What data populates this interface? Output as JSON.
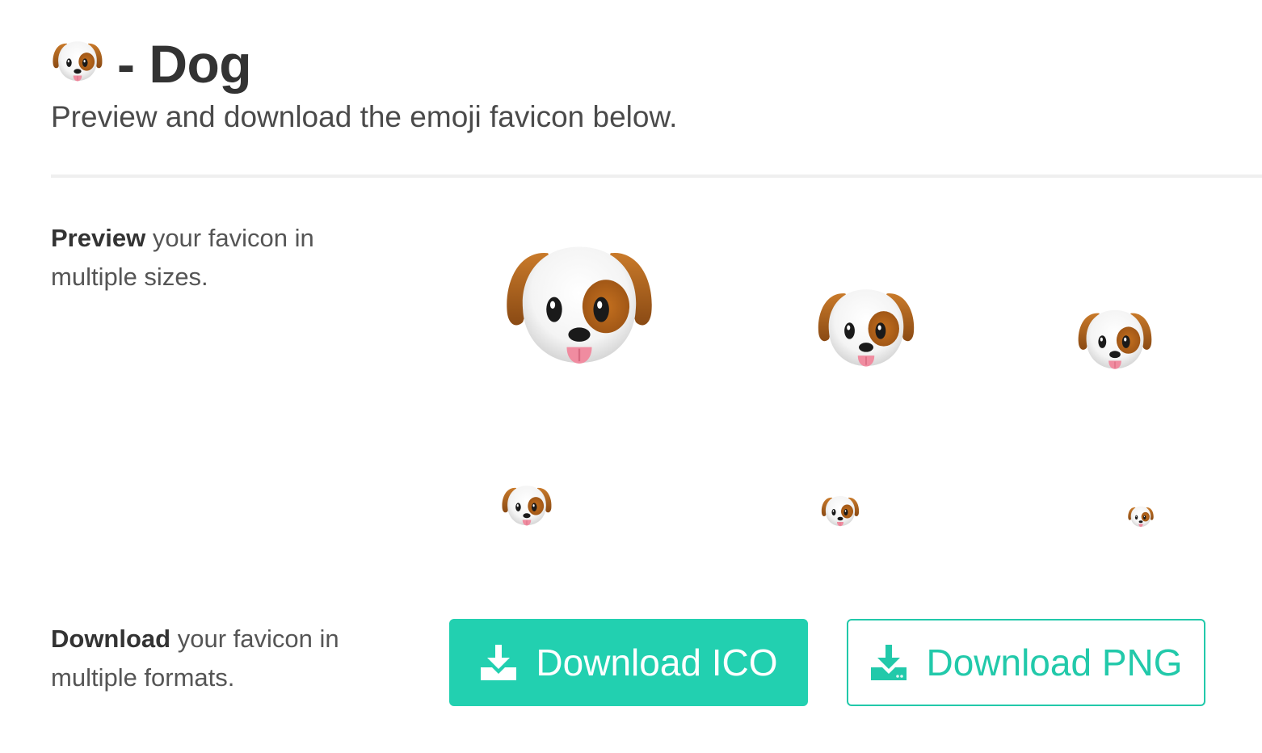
{
  "header": {
    "emoji_icon": "dog-face-icon",
    "title": "- Dog",
    "subtitle": "Preview and download the emoji favicon below."
  },
  "preview": {
    "label_bold": "Preview",
    "label_rest": " your favicon in multiple sizes.",
    "sizes_count": 6
  },
  "download": {
    "label_bold": "Download",
    "label_rest": " your favicon in multiple formats.",
    "ico_button": "Download ICO",
    "png_button": "Download PNG",
    "button_icon": "download-icon"
  },
  "colors": {
    "accent": "#22d0b0",
    "text": "#333333",
    "dog_brown": "#b5651d",
    "dog_tongue": "#f08ca0"
  }
}
